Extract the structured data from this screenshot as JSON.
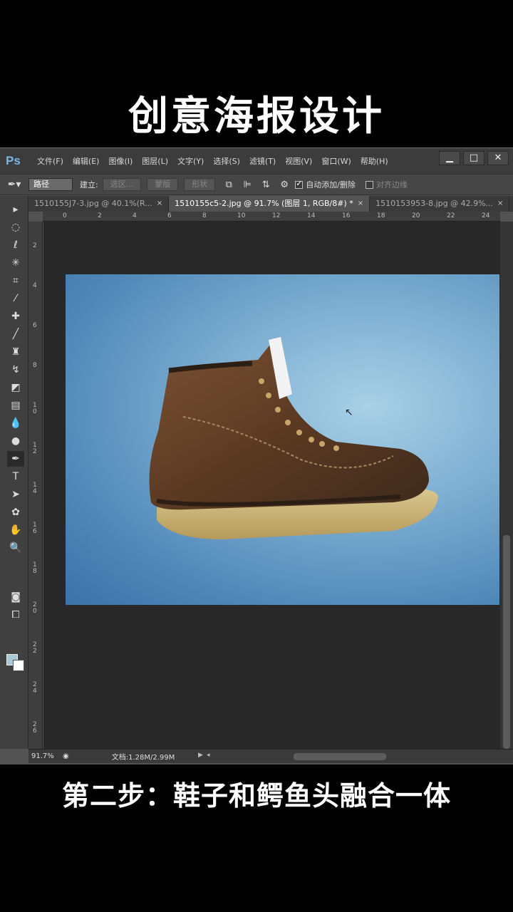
{
  "captions": {
    "top": "创意海报设计",
    "bottom": "第二步：鞋子和鳄鱼头融合一体"
  },
  "app": {
    "logo": "Ps",
    "menus": [
      "文件(F)",
      "编辑(E)",
      "图像(I)",
      "图层(L)",
      "文字(Y)",
      "选择(S)",
      "滤镜(T)",
      "视图(V)",
      "窗口(W)",
      "帮助(H)"
    ],
    "window_controls": {
      "minimize": "▁",
      "maximize": "□",
      "close": "✕"
    }
  },
  "options_bar": {
    "tool_icon": "pen-icon",
    "mode_value": "路径",
    "build_label": "建立:",
    "buttons": [
      "选区...",
      "蒙版",
      "形状"
    ],
    "auto_add_delete_label": "自动添加/删除",
    "auto_add_delete_checked": true,
    "align_edges_label": "对齐边缘",
    "align_edges_checked": false
  },
  "tabs": [
    {
      "label": "1510155J7-3.jpg @ 40.1%(R...",
      "active": false
    },
    {
      "label": "1510155c5-2.jpg @ 91.7% (图层 1, RGB/8#) *",
      "active": true
    },
    {
      "label": "1510153953-8.jpg @ 42.9%...",
      "active": false
    }
  ],
  "tab_close_glyph": "×",
  "ruler": {
    "top_labels": [
      "0",
      "2",
      "4",
      "6",
      "8",
      "10",
      "12",
      "14",
      "16",
      "18",
      "20",
      "22",
      "24"
    ],
    "left_labels": [
      "2",
      "4",
      "6",
      "8",
      "1 0",
      "1 2",
      "1 4",
      "1 6",
      "1 8",
      "2 0",
      "2 2",
      "2 4",
      "2 6"
    ]
  },
  "tools": [
    "move-icon",
    "marquee-icon",
    "lasso-icon",
    "magic-wand-icon",
    "crop-icon",
    "eyedropper-icon",
    "healing-brush-icon",
    "brush-icon",
    "clone-stamp-icon",
    "history-brush-icon",
    "eraser-icon",
    "gradient-icon",
    "blur-icon",
    "dodge-icon",
    "pen-icon",
    "type-icon",
    "path-selection-icon",
    "shape-icon",
    "hand-icon",
    "zoom-icon"
  ],
  "colors": {
    "foreground": "#a8c8d8",
    "background": "#ffffff"
  },
  "status": {
    "zoom": "91.7%",
    "doc": "文档:1.28M/2.99M"
  }
}
